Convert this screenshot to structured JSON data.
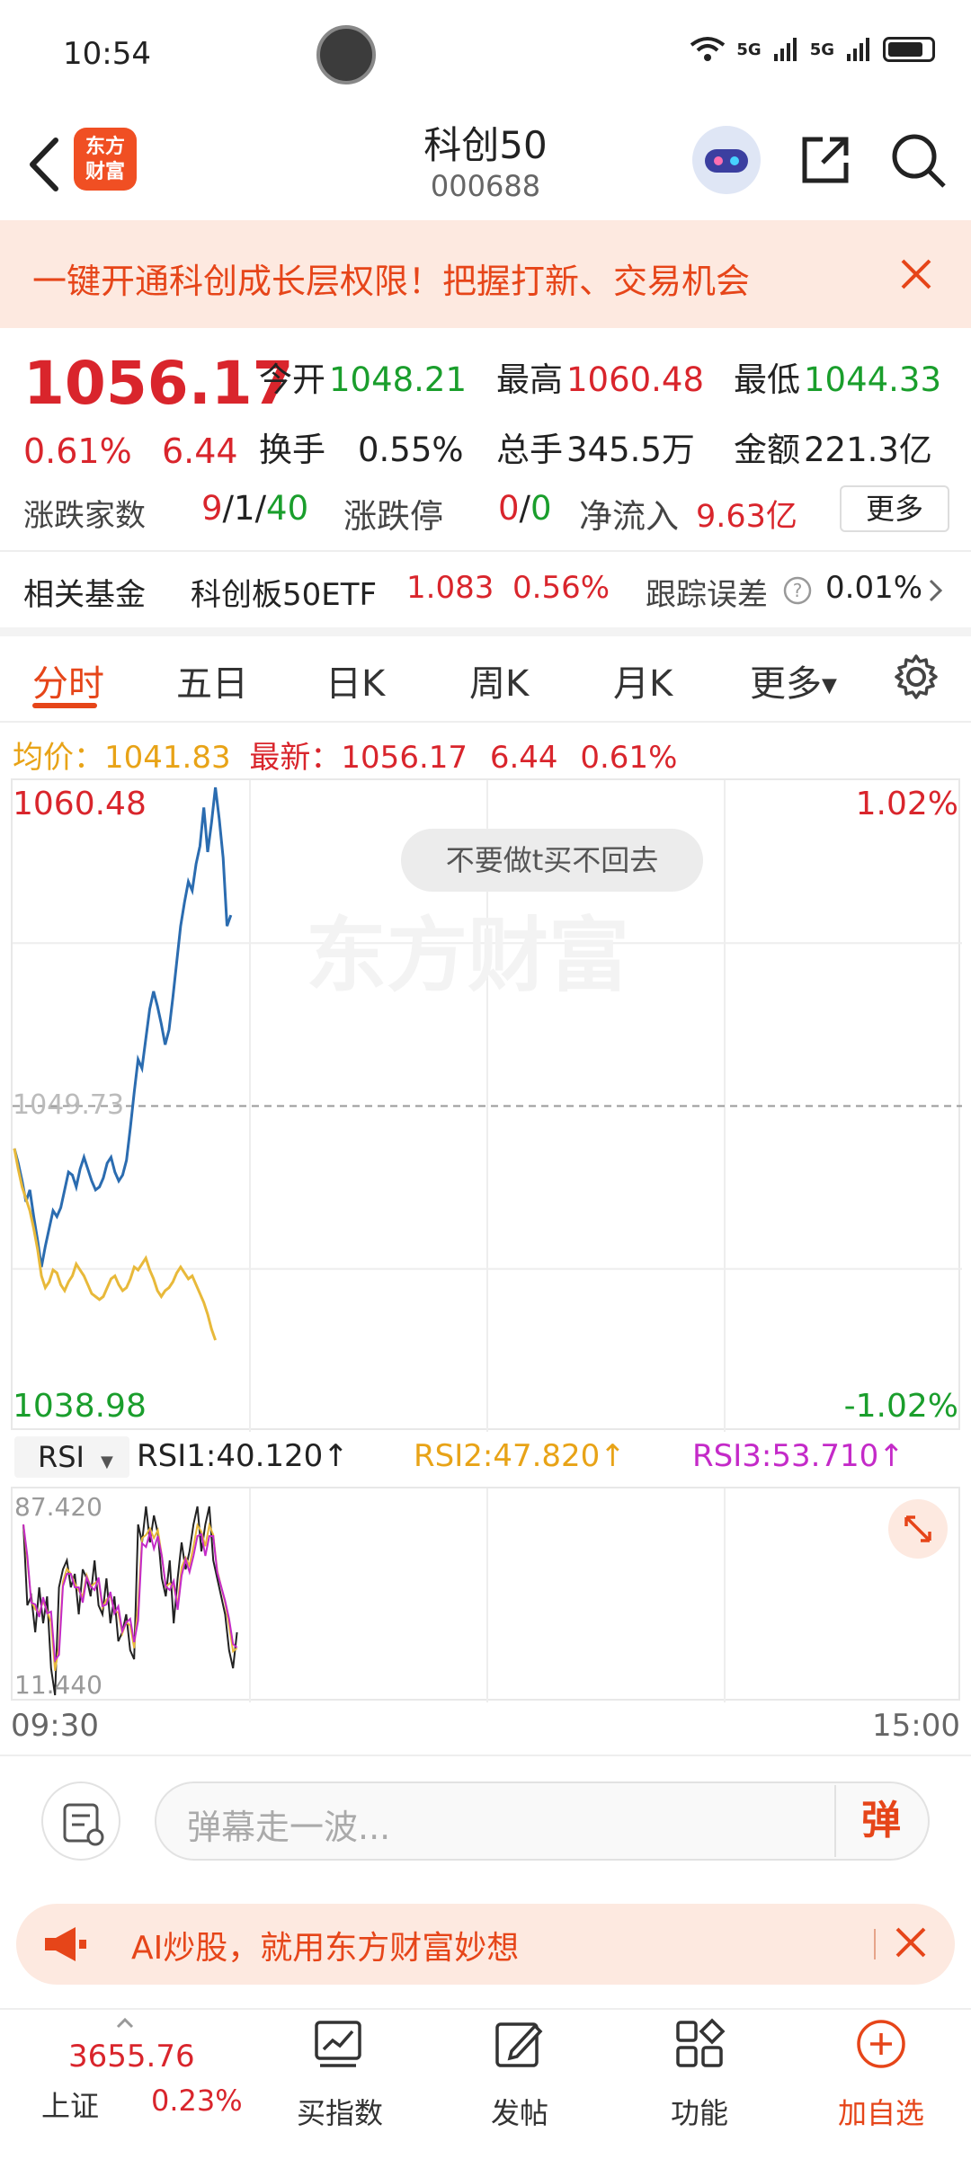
{
  "status": {
    "time": "10:54",
    "net1": "5G",
    "net2": "5G"
  },
  "header": {
    "title": "科创50",
    "code": "000688",
    "logo_line1": "东方",
    "logo_line2": "财富"
  },
  "banner": {
    "text": "一键开通科创成长层权限！把握打新、交易机会"
  },
  "quote": {
    "price": "1056.17",
    "change_pct": "0.61%",
    "change": "6.44",
    "open_label": "今开",
    "open": "1048.21",
    "high_label": "最高",
    "high": "1060.48",
    "low_label": "最低",
    "low": "1044.33",
    "turnover_label": "换手",
    "turnover": "0.55%",
    "volume_label": "总手",
    "volume": "345.5万",
    "amount_label": "金额",
    "amount": "221.3亿",
    "breadth_label": "涨跌家数",
    "up": "9",
    "flat": "1",
    "down": "40",
    "limit_label": "涨跌停",
    "limit_up": "0",
    "limit_down": "0",
    "inflow_label": "净流入",
    "inflow": "9.63亿",
    "more": "更多"
  },
  "fund": {
    "label": "相关基金",
    "name": "科创板50ETF",
    "price": "1.083",
    "pct": "0.56%",
    "err_label": "跟踪误差",
    "err": "0.01%"
  },
  "tabs": [
    "分时",
    "五日",
    "日K",
    "周K",
    "月K",
    "更多"
  ],
  "info": {
    "avg_label": "均价：",
    "avg": "1041.83",
    "last_label": "最新：",
    "last": "1056.17",
    "chg": "6.44",
    "pct": "0.61%"
  },
  "chart": {
    "y_top": "1060.48",
    "y_bottom": "1038.98",
    "y_mid": "1049.73",
    "pct_top": "1.02%",
    "pct_bottom": "-1.02%",
    "tooltip": "不要做t买不回去",
    "watermark": "东方财富"
  },
  "chart_data": {
    "type": "line",
    "ylim": [
      1038.98,
      1060.48
    ],
    "reference": 1049.73,
    "series": [
      {
        "values": [
          1048.3,
          1047.8,
          1047.2,
          1046.5,
          1046.9,
          1046.0,
          1045.2,
          1044.3,
          1045.0,
          1045.6,
          1046.2,
          1046.0,
          1046.3,
          1046.9,
          1047.5,
          1047.4,
          1047.0,
          1047.6,
          1048.0,
          1047.6,
          1047.2,
          1046.9,
          1047.0,
          1047.3,
          1047.8,
          1048.0,
          1047.5,
          1047.2,
          1047.4,
          1047.9,
          1049.0,
          1050.2,
          1051.3,
          1051.0,
          1052.0,
          1053.0,
          1053.6,
          1053.1,
          1052.5,
          1051.8,
          1052.3,
          1053.4,
          1054.6,
          1055.8,
          1056.6,
          1057.3,
          1057.0,
          1057.9,
          1058.5,
          1059.8,
          1058.3,
          1059.3,
          1060.48,
          1059.4,
          1058.1,
          1055.8,
          1056.17
        ]
      },
      {
        "values": [
          1048.3,
          1047.6,
          1047.0,
          1046.6,
          1046.2,
          1045.6,
          1044.9,
          1044.0,
          1043.6,
          1043.8,
          1044.2,
          1044.1,
          1043.7,
          1043.5,
          1043.8,
          1044.0,
          1044.4,
          1044.2,
          1044.0,
          1043.7,
          1043.4,
          1043.3,
          1043.2,
          1043.3,
          1043.6,
          1043.9,
          1044.0,
          1043.7,
          1043.5,
          1043.6,
          1043.9,
          1044.3,
          1044.2,
          1044.4,
          1044.6,
          1044.2,
          1043.9,
          1043.5,
          1043.3,
          1043.5,
          1043.6,
          1043.8,
          1044.1,
          1044.3,
          1044.1,
          1043.9,
          1044.0,
          1043.7,
          1043.4,
          1043.1,
          1042.7,
          1042.2,
          1041.83
        ]
      }
    ]
  },
  "rsi": {
    "select": "RSI",
    "rsi1": "RSI1:40.120↑",
    "rsi2": "RSI2:47.820↑",
    "rsi3": "RSI3:53.710↑",
    "top": "87.420",
    "bottom": "11.440"
  },
  "time_axis": {
    "start": "09:30",
    "end": "15:00"
  },
  "comment": {
    "placeholder": "弹幕走一波...",
    "btn": "弹"
  },
  "ad": {
    "text": "AI炒股，就用东方财富妙想"
  },
  "bottom_nav": {
    "index_value": "3655.76",
    "index_name": "上证",
    "index_pct": "0.23%",
    "items": [
      "买指数",
      "发帖",
      "功能",
      "加自选"
    ]
  },
  "colors": {
    "accent": "#e64519",
    "up": "#d9252c",
    "down": "#1a9e2c",
    "price_line": "#2b6cb0",
    "avg_line": "#e8b93a"
  }
}
